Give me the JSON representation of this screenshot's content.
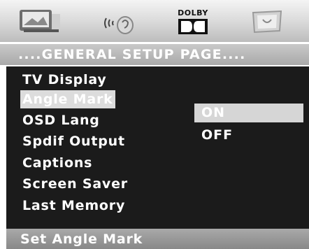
{
  "topbar": {
    "tabs": [
      {
        "icon": "general-setup-icon"
      },
      {
        "icon": "audio-setup-icon"
      },
      {
        "icon": "dolby-logo-icon",
        "label": "DOLBY"
      },
      {
        "icon": "preference-icon"
      }
    ]
  },
  "page_title": "....GENERAL SETUP PAGE....",
  "menu": {
    "items": [
      {
        "label": "TV Display"
      },
      {
        "label": "Angle Mark"
      },
      {
        "label": "OSD Lang"
      },
      {
        "label": "Spdif Output"
      },
      {
        "label": "Captions"
      },
      {
        "label": "Screen Saver"
      },
      {
        "label": "Last Memory"
      }
    ],
    "selected_index": 1
  },
  "options": {
    "items": [
      {
        "label": "ON"
      },
      {
        "label": "OFF"
      }
    ],
    "selected_index": 0
  },
  "status": "Set Angle Mark",
  "colors": {
    "panel_bg": "#1b1b1b",
    "highlight": "#dcdcdc",
    "text": "#ffffff"
  }
}
